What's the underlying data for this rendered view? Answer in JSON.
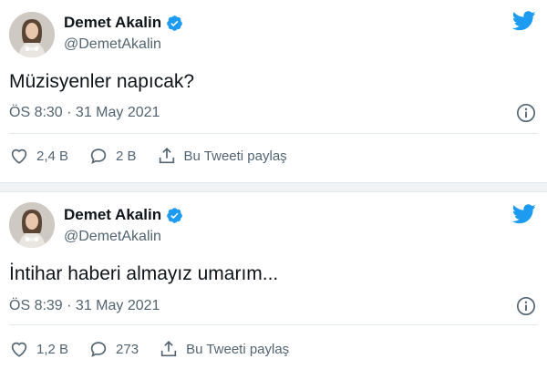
{
  "tweets": [
    {
      "author_name": "Demet Akalin",
      "handle": "@DemetAkalin",
      "text": "Müzisyenler napıcak?",
      "timestamp": "ÖS 8:30 · 31 May 2021",
      "likes": "2,4 B",
      "replies": "2 B",
      "share_label": "Bu Tweeti paylaş"
    },
    {
      "author_name": "Demet Akalin",
      "handle": "@DemetAkalin",
      "text": "İntihar haberi almayız umarım...",
      "timestamp": "ÖS 8:39 · 31 May 2021",
      "likes": "1,2 B",
      "replies": "273",
      "share_label": "Bu Tweeti paylaş"
    }
  ],
  "colors": {
    "twitter_blue": "#1d9bf0",
    "text_primary": "#0f1419",
    "text_secondary": "#536471",
    "divider": "#e1e8ed"
  },
  "icons": {
    "brand": "twitter-bird-icon",
    "verified": "verified-badge-icon",
    "info": "info-icon",
    "like": "heart-icon",
    "reply": "reply-bubble-icon",
    "share": "share-icon"
  }
}
